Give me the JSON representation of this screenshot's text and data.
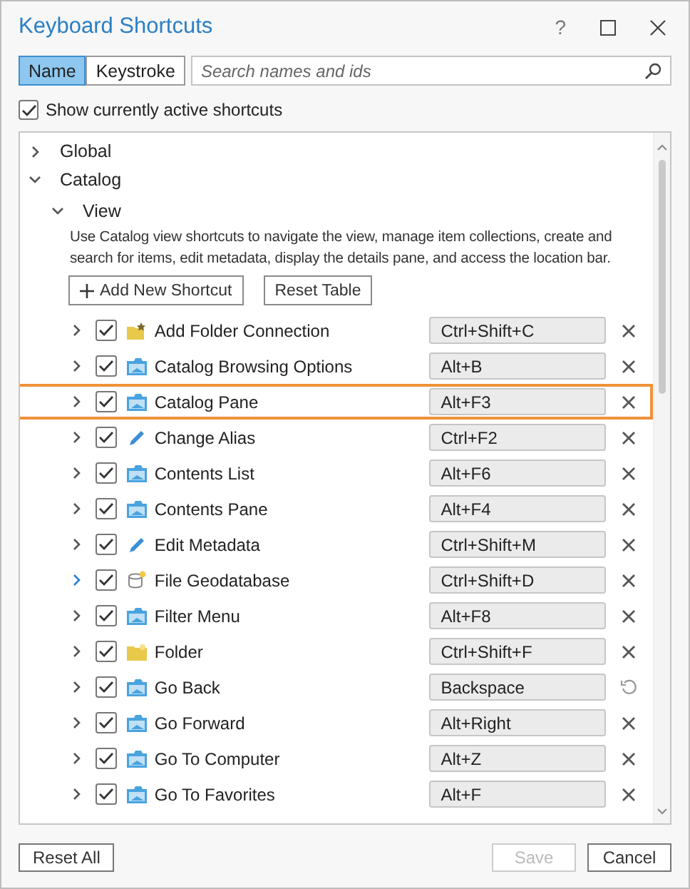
{
  "window": {
    "title": "Keyboard Shortcuts",
    "help": "?"
  },
  "search_modes": [
    {
      "label": "Name",
      "selected": true
    },
    {
      "label": "Keystroke",
      "selected": false
    }
  ],
  "search": {
    "placeholder": "Search names and ids"
  },
  "show_active": {
    "label": "Show currently active shortcuts",
    "checked": true
  },
  "tree": [
    {
      "label": "Global",
      "expanded": false
    },
    {
      "label": "Catalog",
      "expanded": true,
      "children": [
        {
          "label": "View",
          "expanded": true,
          "description": "Use Catalog view shortcuts to navigate the view, manage item collections, create and search for items, edit metadata, display the details pane, and access the location bar.",
          "buttons": [
            "Add New Shortcut",
            "Reset Table"
          ],
          "shortcuts": [
            {
              "name": "Add Folder Connection",
              "kind": "folder-add",
              "enabled": true,
              "keystroke": "Ctrl+Shift+C",
              "is_default": false,
              "selected": false,
              "hovered": false
            },
            {
              "name": "Catalog Browsing Options",
              "kind": "pane",
              "enabled": true,
              "keystroke": "Alt+B",
              "is_default": false,
              "selected": false,
              "hovered": false
            },
            {
              "name": "Catalog Pane",
              "kind": "pane",
              "enabled": true,
              "keystroke": "Alt+F3",
              "is_default": false,
              "selected": true,
              "hovered": false
            },
            {
              "name": "Change Alias",
              "kind": "pencil",
              "enabled": true,
              "keystroke": "Ctrl+F2",
              "is_default": false,
              "selected": false,
              "hovered": false
            },
            {
              "name": "Contents List",
              "kind": "pane",
              "enabled": true,
              "keystroke": "Alt+F6",
              "is_default": false,
              "selected": false,
              "hovered": false
            },
            {
              "name": "Contents Pane",
              "kind": "pane",
              "enabled": true,
              "keystroke": "Alt+F4",
              "is_default": false,
              "selected": false,
              "hovered": false
            },
            {
              "name": "Edit Metadata",
              "kind": "pencil",
              "enabled": true,
              "keystroke": "Ctrl+Shift+M",
              "is_default": false,
              "selected": false,
              "hovered": false
            },
            {
              "name": "File Geodatabase",
              "kind": "database",
              "enabled": true,
              "keystroke": "Ctrl+Shift+D",
              "is_default": false,
              "selected": false,
              "hovered": true
            },
            {
              "name": "Filter Menu",
              "kind": "pane",
              "enabled": true,
              "keystroke": "Alt+F8",
              "is_default": false,
              "selected": false,
              "hovered": false
            },
            {
              "name": "Folder",
              "kind": "folder",
              "enabled": true,
              "keystroke": "Ctrl+Shift+F",
              "is_default": false,
              "selected": false,
              "hovered": false
            },
            {
              "name": "Go Back",
              "kind": "pane",
              "enabled": true,
              "keystroke": "Backspace",
              "is_default": true,
              "selected": false,
              "hovered": false
            },
            {
              "name": "Go Forward",
              "kind": "pane",
              "enabled": true,
              "keystroke": "Alt+Right",
              "is_default": false,
              "selected": false,
              "hovered": false
            },
            {
              "name": "Go To Computer",
              "kind": "pane",
              "enabled": true,
              "keystroke": "Alt+Z",
              "is_default": false,
              "selected": false,
              "hovered": false
            },
            {
              "name": "Go To Favorites",
              "kind": "pane",
              "enabled": true,
              "keystroke": "Alt+F",
              "is_default": false,
              "selected": false,
              "hovered": false
            }
          ]
        }
      ]
    }
  ],
  "footer": {
    "reset_all": "Reset All",
    "save": {
      "label": "Save",
      "disabled": true
    },
    "cancel": "Cancel"
  }
}
